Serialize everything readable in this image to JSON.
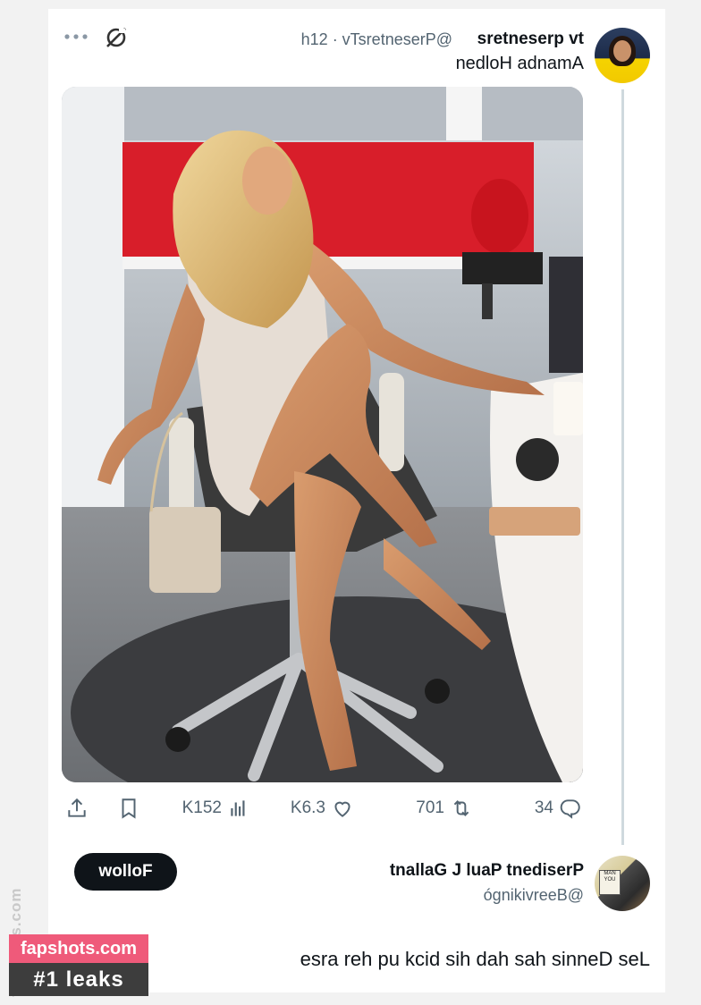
{
  "tweet": {
    "author_name": "tv presenters",
    "author_handle": "@PresentersTv · 21h",
    "text": "Amanda Holden",
    "actions": {
      "replies": "43",
      "retweets": "107",
      "likes": "3.6K",
      "views": "251K"
    }
  },
  "reply": {
    "author_name": "President Paul J Gallant",
    "author_handle": "@Beervikingó",
    "follow_label": "Follow",
    "text": "Les Dennis has had his dick up her arse",
    "avatar_sign": "MAN YOU"
  },
  "watermark": {
    "side": "fapshots.com",
    "site": "fapshots.com",
    "tag": "#1 leaks"
  },
  "colors": {
    "follow_bg": "#0f1419",
    "watermark_pink": "#ef5a7a",
    "watermark_dark": "#3d3d3d",
    "studio_red": "#d81e2a"
  },
  "icons": [
    "more-icon",
    "grok-icon",
    "reply-icon",
    "retweet-icon",
    "like-icon",
    "views-icon",
    "bookmark-icon",
    "share-icon"
  ]
}
